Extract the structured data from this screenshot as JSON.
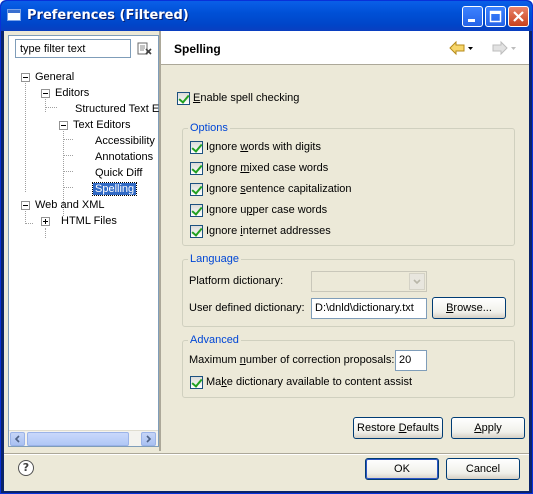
{
  "window": {
    "title": "Preferences (Filtered)"
  },
  "filter": {
    "placeholder": "type filter text",
    "value": "type filter text"
  },
  "tree": [
    {
      "label": "General"
    },
    {
      "label": "Editors"
    },
    {
      "label": "Structured Text E"
    },
    {
      "label": "Text Editors"
    },
    {
      "label": "Accessibility"
    },
    {
      "label": "Annotations"
    },
    {
      "label": "Quick Diff"
    },
    {
      "label": "Spelling"
    },
    {
      "label": "Web and XML"
    },
    {
      "label": "HTML Files"
    }
  ],
  "page": {
    "title": "Spelling"
  },
  "enable_spell": {
    "label": "Enable spell checking",
    "mn": "E",
    "rest": "nable spell checking",
    "checked": true
  },
  "options": {
    "title": "Options",
    "items": [
      {
        "a": "Ignore ",
        "m": "w",
        "b": "ords with digits",
        "checked": true
      },
      {
        "a": "Ignore ",
        "m": "m",
        "b": "ixed case words",
        "checked": true
      },
      {
        "a": "Ignore ",
        "m": "s",
        "b": "entence capitalization",
        "checked": true
      },
      {
        "a": "Ignore u",
        "m": "p",
        "b": "per case words",
        "checked": true
      },
      {
        "a": "Ignore ",
        "m": "i",
        "b": "nternet addresses",
        "checked": true
      }
    ]
  },
  "language": {
    "title": "Language",
    "platform_label": "Platform dictionary:",
    "platform_value": "",
    "user_label": "User defined dictionary:",
    "user_value": "D:\\dnld\\dictionary.txt",
    "browse": {
      "a": "",
      "m": "B",
      "b": "rowse..."
    }
  },
  "advanced": {
    "title": "Advanced",
    "max_label_a": "Maximum ",
    "max_label_m": "n",
    "max_label_b": "umber of correction proposals:",
    "max_value": "20",
    "assist": {
      "a": "Ma",
      "m": "k",
      "b": "e dictionary available to content assist",
      "checked": true
    }
  },
  "buttons": {
    "restore": {
      "a": "Restore ",
      "m": "D",
      "b": "efaults"
    },
    "apply": {
      "a": "",
      "m": "A",
      "b": "pply"
    },
    "ok": "OK",
    "cancel": "Cancel",
    "help": "?"
  },
  "colors": {
    "titlebar": "#0050d6",
    "selection": "#316ac5",
    "group_title": "#0046d5",
    "dialog_bg": "#ece9d8"
  },
  "icons": [
    "window-icon",
    "minimize-icon",
    "maximize-icon",
    "close-icon",
    "clear-filter-icon",
    "back-arrow-icon",
    "forward-arrow-icon",
    "help-icon"
  ]
}
